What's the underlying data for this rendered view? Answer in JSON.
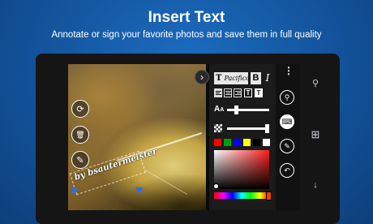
{
  "header": {
    "title": "Insert Text",
    "subtitle": "Annotate or sign your favorite photos and save them in full quality"
  },
  "photo": {
    "signature_text": "by bsautermeister"
  },
  "left_tools": [
    {
      "name": "rotate-icon",
      "glyph": "⟳"
    },
    {
      "name": "delete-icon",
      "glyph": "🗑"
    },
    {
      "name": "pen-icon",
      "glyph": "✎"
    }
  ],
  "text_panel": {
    "font_glyph": "T",
    "font_name": "Pacifico",
    "bold_label": "B",
    "italic_label": "I",
    "size_label": "A",
    "size_label_small": "A",
    "shape_labels": [
      "T",
      "T"
    ],
    "text_size_level": 0.22,
    "opacity_level": 0.95,
    "selected_align": "left",
    "swatches": [
      "#ff0000",
      "#00a000",
      "#0000ff",
      "#ffff00",
      "#000000",
      "#ffffff"
    ],
    "selected_color": "#ff3a00"
  },
  "actions": [
    {
      "name": "zoom-icon",
      "glyph": "⚲"
    },
    {
      "name": "keyboard-icon",
      "glyph": "⌨"
    },
    {
      "name": "brush-icon",
      "glyph": "✎"
    },
    {
      "name": "undo-icon",
      "glyph": "↶"
    }
  ],
  "more_glyph": "⋮",
  "expander_glyph": "›",
  "phone_nav": [
    {
      "name": "search-icon",
      "glyph": "⚲"
    },
    {
      "name": "windows-icon",
      "glyph": "⊞"
    },
    {
      "name": "back-down-icon",
      "glyph": "↓"
    }
  ]
}
